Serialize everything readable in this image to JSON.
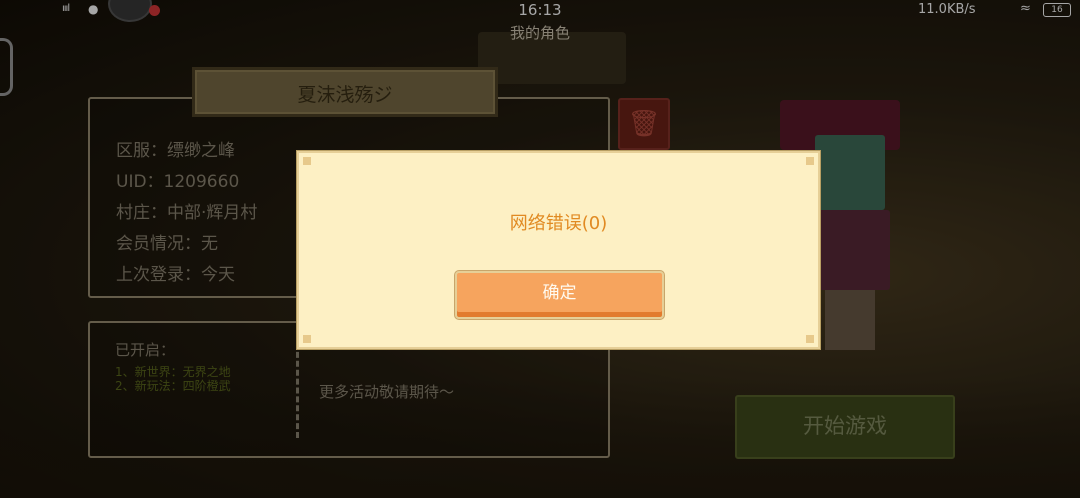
{
  "status_bar": {
    "signal": "ıııl",
    "time": "16:13",
    "net_speed": "11.0KB/s",
    "wifi_icon": "wifi-icon",
    "battery": "16"
  },
  "page": {
    "title": "我的角色"
  },
  "role": {
    "name": "夏沫浅殇ジ",
    "server": "区服：缥缈之峰",
    "uid": "UID：1209660",
    "village": "村庄：中部·辉月村",
    "membership": "会员情况：无",
    "last_login": "上次登录：今天"
  },
  "activities": {
    "title": "已开启：",
    "items": [
      "1、新世界：无界之地",
      "2、新玩法：四阶橙武"
    ],
    "more": "更多活动敬请期待～"
  },
  "start_button": {
    "label": "开始游戏"
  },
  "dialog": {
    "message": "网络错误(0)",
    "ok_label": "确定"
  },
  "colors": {
    "dialog_bg": "#fdf0c4",
    "dialog_text": "#e18a22",
    "ok_button": "#f6a45e"
  }
}
